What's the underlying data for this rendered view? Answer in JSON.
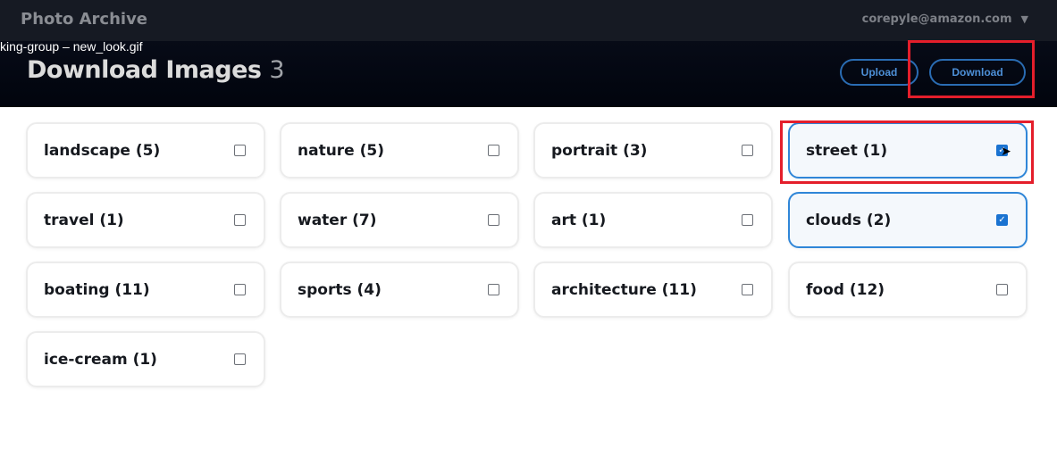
{
  "topbar": {
    "app_title": "Photo Archive",
    "user_email": "corepyle@amazon.com",
    "caret": "▼"
  },
  "overlay_label": "king-group  – new_look.gif",
  "header": {
    "title": "Download Images",
    "count": "3",
    "upload_label": "Upload",
    "download_label": "Download"
  },
  "tags": [
    {
      "label": "landscape (5)",
      "checked": false
    },
    {
      "label": "nature (5)",
      "checked": false
    },
    {
      "label": "portrait (3)",
      "checked": false
    },
    {
      "label": "street (1)",
      "checked": true
    },
    {
      "label": "travel (1)",
      "checked": false
    },
    {
      "label": "water (7)",
      "checked": false
    },
    {
      "label": "art (1)",
      "checked": false
    },
    {
      "label": "clouds (2)",
      "checked": true
    },
    {
      "label": "boating (11)",
      "checked": false
    },
    {
      "label": "sports (4)",
      "checked": false
    },
    {
      "label": "architecture (11)",
      "checked": false
    },
    {
      "label": "food (12)",
      "checked": false
    },
    {
      "label": "ice-cream (1)",
      "checked": false
    }
  ],
  "colors": {
    "accent": "#1a73d1",
    "annotation": "#e41e2b"
  }
}
